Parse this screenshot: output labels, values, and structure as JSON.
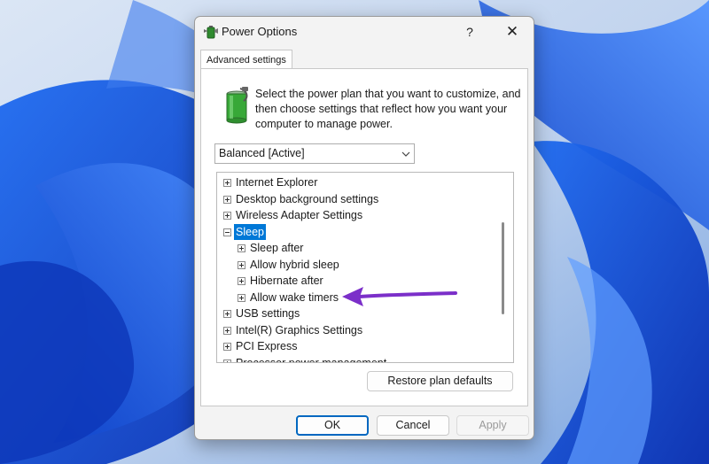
{
  "window": {
    "title": "Power Options",
    "help_glyph": "?",
    "close_glyph": "✕"
  },
  "tab": {
    "label": "Advanced settings"
  },
  "intro_text": "Select the power plan that you want to customize, and then choose settings that reflect how you want your computer to manage power.",
  "plan_select": {
    "value": "Balanced [Active]"
  },
  "tree": {
    "items": [
      {
        "label": "Internet Explorer",
        "expander": "plus"
      },
      {
        "label": "Desktop background settings",
        "expander": "plus"
      },
      {
        "label": "Wireless Adapter Settings",
        "expander": "plus"
      },
      {
        "label": "Sleep",
        "expander": "minus",
        "selected": true
      },
      {
        "label": "Sleep after",
        "expander": "plus"
      },
      {
        "label": "Allow hybrid sleep",
        "expander": "plus"
      },
      {
        "label": "Hibernate after",
        "expander": "plus"
      },
      {
        "label": "Allow wake timers",
        "expander": "plus"
      },
      {
        "label": "USB settings",
        "expander": "plus"
      },
      {
        "label": "Intel(R) Graphics Settings",
        "expander": "plus"
      },
      {
        "label": "PCI Express",
        "expander": "plus"
      },
      {
        "label": "Processor power management",
        "expander": "plus"
      }
    ]
  },
  "buttons": {
    "restore": "Restore plan defaults",
    "ok": "OK",
    "cancel": "Cancel",
    "apply": "Apply"
  },
  "colors": {
    "selection": "#0078d7",
    "annotation_arrow": "#7b2fc9",
    "ok_border": "#0067c0"
  },
  "icons": {
    "title": "power-options-icon",
    "panel": "battery-icon",
    "dropdown": "chevron-down-icon",
    "annotation": "arrow-pointer"
  }
}
